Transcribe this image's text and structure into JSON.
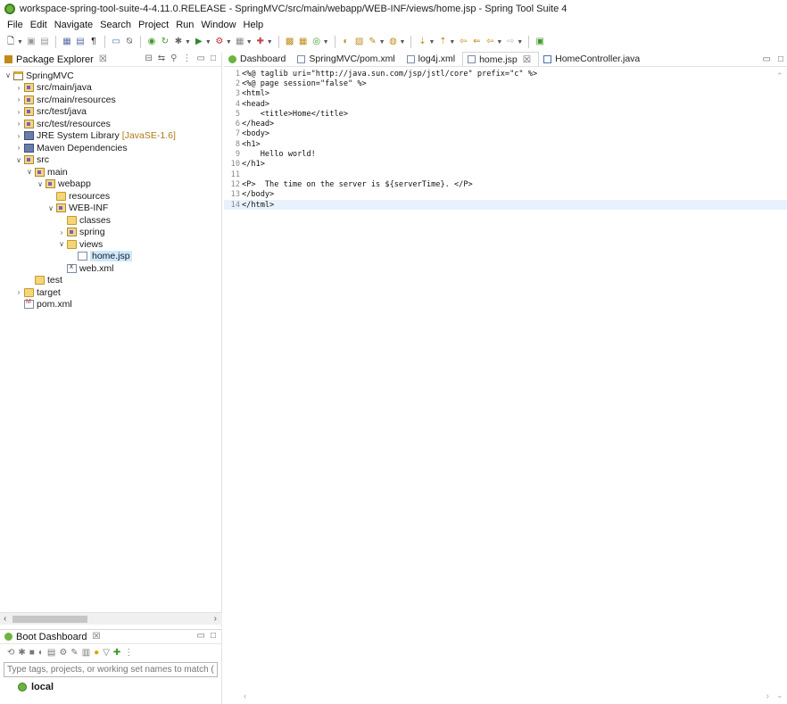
{
  "window": {
    "title": "workspace-spring-tool-suite-4-4.11.0.RELEASE - SpringMVC/src/main/webapp/WEB-INF/views/home.jsp - Spring Tool Suite 4"
  },
  "menu": [
    "File",
    "Edit",
    "Navigate",
    "Search",
    "Project",
    "Run",
    "Window",
    "Help"
  ],
  "package_explorer": {
    "title": "Package Explorer",
    "close": "☒",
    "tree": [
      {
        "label": "SpringMVC",
        "indent": 0,
        "twisty": "open",
        "icon": "project"
      },
      {
        "label": "src/main/java",
        "indent": 1,
        "twisty": "closed",
        "icon": "srcfolder"
      },
      {
        "label": "src/main/resources",
        "indent": 1,
        "twisty": "closed",
        "icon": "srcfolder"
      },
      {
        "label": "src/test/java",
        "indent": 1,
        "twisty": "closed",
        "icon": "srcfolder"
      },
      {
        "label": "src/test/resources",
        "indent": 1,
        "twisty": "closed",
        "icon": "srcfolder"
      },
      {
        "label": "JRE System Library",
        "decoration": "[JavaSE-1.6]",
        "indent": 1,
        "twisty": "closed",
        "icon": "lib"
      },
      {
        "label": "Maven Dependencies",
        "indent": 1,
        "twisty": "closed",
        "icon": "lib"
      },
      {
        "label": "src",
        "indent": 1,
        "twisty": "open",
        "icon": "srcfolder"
      },
      {
        "label": "main",
        "indent": 2,
        "twisty": "open",
        "icon": "srcfolder"
      },
      {
        "label": "webapp",
        "indent": 3,
        "twisty": "open",
        "icon": "srcfolder"
      },
      {
        "label": "resources",
        "indent": 4,
        "twisty": "none",
        "icon": "folder"
      },
      {
        "label": "WEB-INF",
        "indent": 4,
        "twisty": "open",
        "icon": "srcfolder"
      },
      {
        "label": "classes",
        "indent": 5,
        "twisty": "none",
        "icon": "folder"
      },
      {
        "label": "spring",
        "indent": 5,
        "twisty": "closed",
        "icon": "srcfolder"
      },
      {
        "label": "views",
        "indent": 5,
        "twisty": "open",
        "icon": "folder"
      },
      {
        "label": "home.jsp",
        "indent": 6,
        "twisty": "none",
        "icon": "jsp",
        "selected": true
      },
      {
        "label": "web.xml",
        "indent": 5,
        "twisty": "none",
        "icon": "xml"
      },
      {
        "label": "test",
        "indent": 2,
        "twisty": "none",
        "icon": "folder"
      },
      {
        "label": "target",
        "indent": 1,
        "twisty": "closed",
        "icon": "folder"
      },
      {
        "label": "pom.xml",
        "indent": 1,
        "twisty": "none",
        "icon": "pom"
      }
    ]
  },
  "boot_dashboard": {
    "title": "Boot Dashboard",
    "close": "☒",
    "filter_placeholder": "Type tags, projects, or working set names to match (incl.",
    "local_label": "local"
  },
  "editor": {
    "tabs": [
      {
        "label": "Dashboard",
        "icon": "dashboard"
      },
      {
        "label": "SpringMVC/pom.xml",
        "icon": "pom"
      },
      {
        "label": "log4j.xml",
        "icon": "xml"
      },
      {
        "label": "home.jsp",
        "icon": "jsp",
        "active": true,
        "close": "☒"
      },
      {
        "label": "HomeController.java",
        "icon": "java"
      }
    ],
    "lines": [
      "<%@ taglib uri=\"http://java.sun.com/jsp/jstl/core\" prefix=\"c\" %>",
      "<%@ page session=\"false\" %>",
      "<html>",
      "<head>",
      "    <title>Home</title>",
      "</head>",
      "<body>",
      "<h1>",
      "    Hello world!",
      "</h1>",
      "",
      "<P>  The time on the server is ${serverTime}. </P>",
      "</body>",
      "</html>"
    ],
    "current_line": 14
  }
}
